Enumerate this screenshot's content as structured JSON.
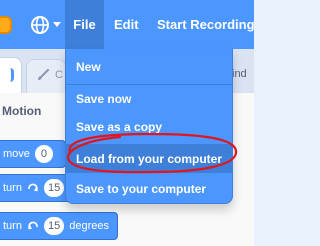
{
  "menubar": {
    "items": [
      {
        "label": "File"
      },
      {
        "label": "Edit"
      },
      {
        "label": "Start Recording"
      }
    ]
  },
  "tabs": {
    "costumes_partial": "C",
    "sounds_partial": "ind"
  },
  "palette": {
    "section_title": "Motion",
    "blocks": {
      "move": {
        "label": "move",
        "value": "0"
      },
      "turn_right": {
        "label": "turn",
        "value": "15"
      },
      "turn_left": {
        "label": "turn",
        "value": "15",
        "suffix": "degrees"
      }
    }
  },
  "file_menu": {
    "items": [
      {
        "label": "New"
      },
      {
        "label": "Save now"
      },
      {
        "label": "Save as a copy"
      },
      {
        "label": "Load from your computer"
      },
      {
        "label": "Save to your computer"
      }
    ],
    "highlighted_item": "Load from your computer"
  },
  "colors": {
    "menubar": "#4c97ff",
    "menu_highlight": "#3d7fd9",
    "annotation": "#e0161e"
  },
  "icons": [
    "scratch-cat-icon",
    "globe-icon",
    "chevron-down-icon",
    "paintbrush-icon",
    "rotate-right-icon",
    "rotate-left-icon"
  ]
}
